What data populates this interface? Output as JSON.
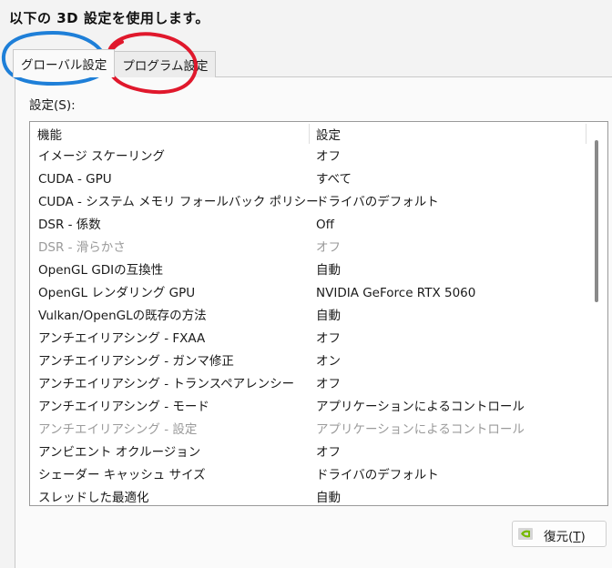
{
  "header": {
    "title": "以下の 3D 設定を使用します。"
  },
  "tabs": [
    {
      "label": "グローバル設定",
      "active": true
    },
    {
      "label": "プログラム設定",
      "active": false
    }
  ],
  "settings": {
    "label": "設定(S):",
    "columns": {
      "feature": "機能",
      "setting": "設定"
    },
    "rows": [
      {
        "feature": "イメージ スケーリング",
        "value": "オフ",
        "enabled": true
      },
      {
        "feature": "CUDA - GPU",
        "value": "すべて",
        "enabled": true
      },
      {
        "feature": "CUDA - システム メモリ フォールバック ポリシー",
        "value": "ドライバのデフォルト",
        "enabled": true
      },
      {
        "feature": "DSR - 係数",
        "value": "Off",
        "enabled": true
      },
      {
        "feature": "DSR - 滑らかさ",
        "value": "オフ",
        "enabled": false
      },
      {
        "feature": "OpenGL GDIの互換性",
        "value": "自動",
        "enabled": true
      },
      {
        "feature": "OpenGL レンダリング GPU",
        "value": "NVIDIA GeForce RTX 5060",
        "enabled": true
      },
      {
        "feature": "Vulkan/OpenGLの既存の方法",
        "value": "自動",
        "enabled": true
      },
      {
        "feature": "アンチエイリアシング - FXAA",
        "value": "オフ",
        "enabled": true
      },
      {
        "feature": "アンチエイリアシング - ガンマ修正",
        "value": "オン",
        "enabled": true
      },
      {
        "feature": "アンチエイリアシング - トランスペアレンシー",
        "value": "オフ",
        "enabled": true
      },
      {
        "feature": "アンチエイリアシング - モード",
        "value": "アプリケーションによるコントロール",
        "enabled": true
      },
      {
        "feature": "アンチエイリアシング - 設定",
        "value": "アプリケーションによるコントロール",
        "enabled": false
      },
      {
        "feature": "アンビエント オクルージョン",
        "value": "オフ",
        "enabled": true
      },
      {
        "feature": "シェーダー キャッシュ サイズ",
        "value": "ドライバのデフォルト",
        "enabled": true
      },
      {
        "feature": "スレッドした最適化",
        "value": "自動",
        "enabled": true
      }
    ]
  },
  "restore_button": {
    "label": "復元(",
    "mnemonic": "T",
    "suffix": ")"
  },
  "colors": {
    "annotation_blue": "#1e7fd8",
    "annotation_red": "#e0182c",
    "nvidia_green": "#76b900"
  }
}
